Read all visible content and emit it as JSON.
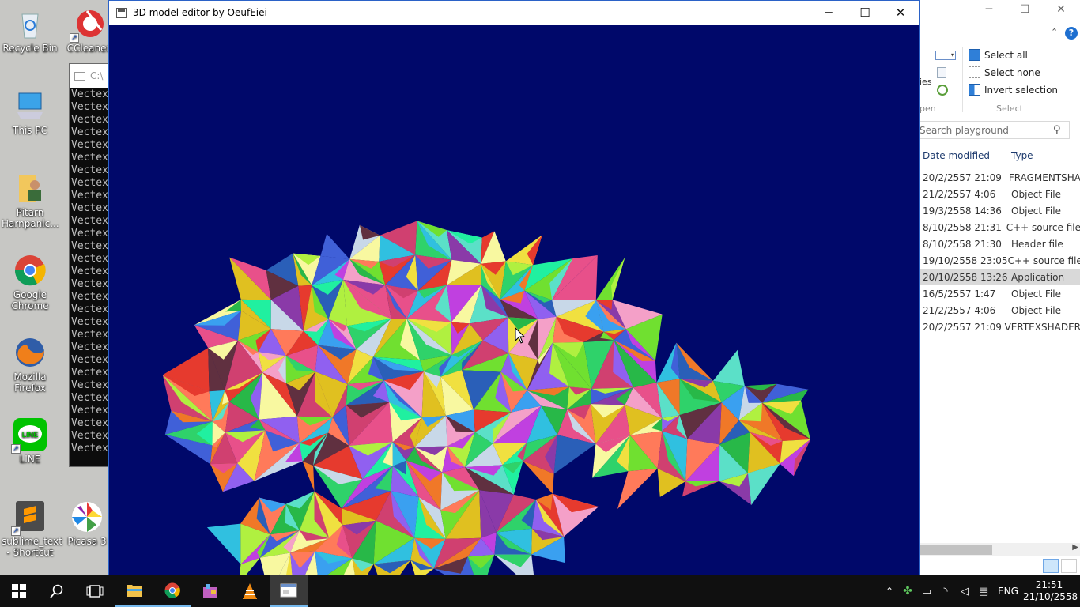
{
  "desktop": {
    "icons": [
      {
        "label": "Recycle Bin"
      },
      {
        "label": "CCleaner"
      },
      {
        "label": "This PC"
      },
      {
        "label": "Pitarn Harnpanic..."
      },
      {
        "label": "Google Chrome"
      },
      {
        "label": "Mozilla Firefox"
      },
      {
        "label": "LINE"
      },
      {
        "label": "sublime_text - Shortcut"
      },
      {
        "label": "Picasa 3"
      }
    ]
  },
  "console": {
    "title": "C:\\",
    "line_text": "Vectex"
  },
  "main_window": {
    "title": "3D model editor by OeufEiei",
    "minimize": "─",
    "maximize": "☐",
    "close": "✕"
  },
  "explorer": {
    "minimize": "─",
    "maximize": "☐",
    "close": "✕",
    "ribbon": {
      "select_all": "Select all",
      "select_none": "Select none",
      "invert_selection": "Invert selection",
      "group_label": "Select",
      "partial_left_1": "ies",
      "partial_left_2": "pen"
    },
    "search_placeholder": "Search playground",
    "columns": {
      "date": "Date modified",
      "type": "Type"
    },
    "files": [
      {
        "date": "20/2/2557 21:09",
        "type": "FRAGMENTSHA"
      },
      {
        "date": "21/2/2557 4:06",
        "type": "Object File"
      },
      {
        "date": "19/3/2558 14:36",
        "type": "Object File"
      },
      {
        "date": "8/10/2558 21:31",
        "type": "C++ source file"
      },
      {
        "date": "8/10/2558 21:30",
        "type": "Header file"
      },
      {
        "date": "19/10/2558 23:05",
        "type": "C++ source file"
      },
      {
        "date": "20/10/2558 13:26",
        "type": "Application",
        "selected": true
      },
      {
        "date": "16/5/2557 1:47",
        "type": "Object File"
      },
      {
        "date": "21/2/2557 4:06",
        "type": "Object File"
      },
      {
        "date": "20/2/2557 21:09",
        "type": "VERTEXSHADER"
      }
    ]
  },
  "taskbar": {
    "language": "ENG",
    "time": "21:51",
    "date": "21/10/2558"
  },
  "colors": {
    "viewport_bg": "#00086a",
    "taskbar_bg": "#101010",
    "selection_bg": "#d9d9d9",
    "accent": "#76b9ed"
  }
}
